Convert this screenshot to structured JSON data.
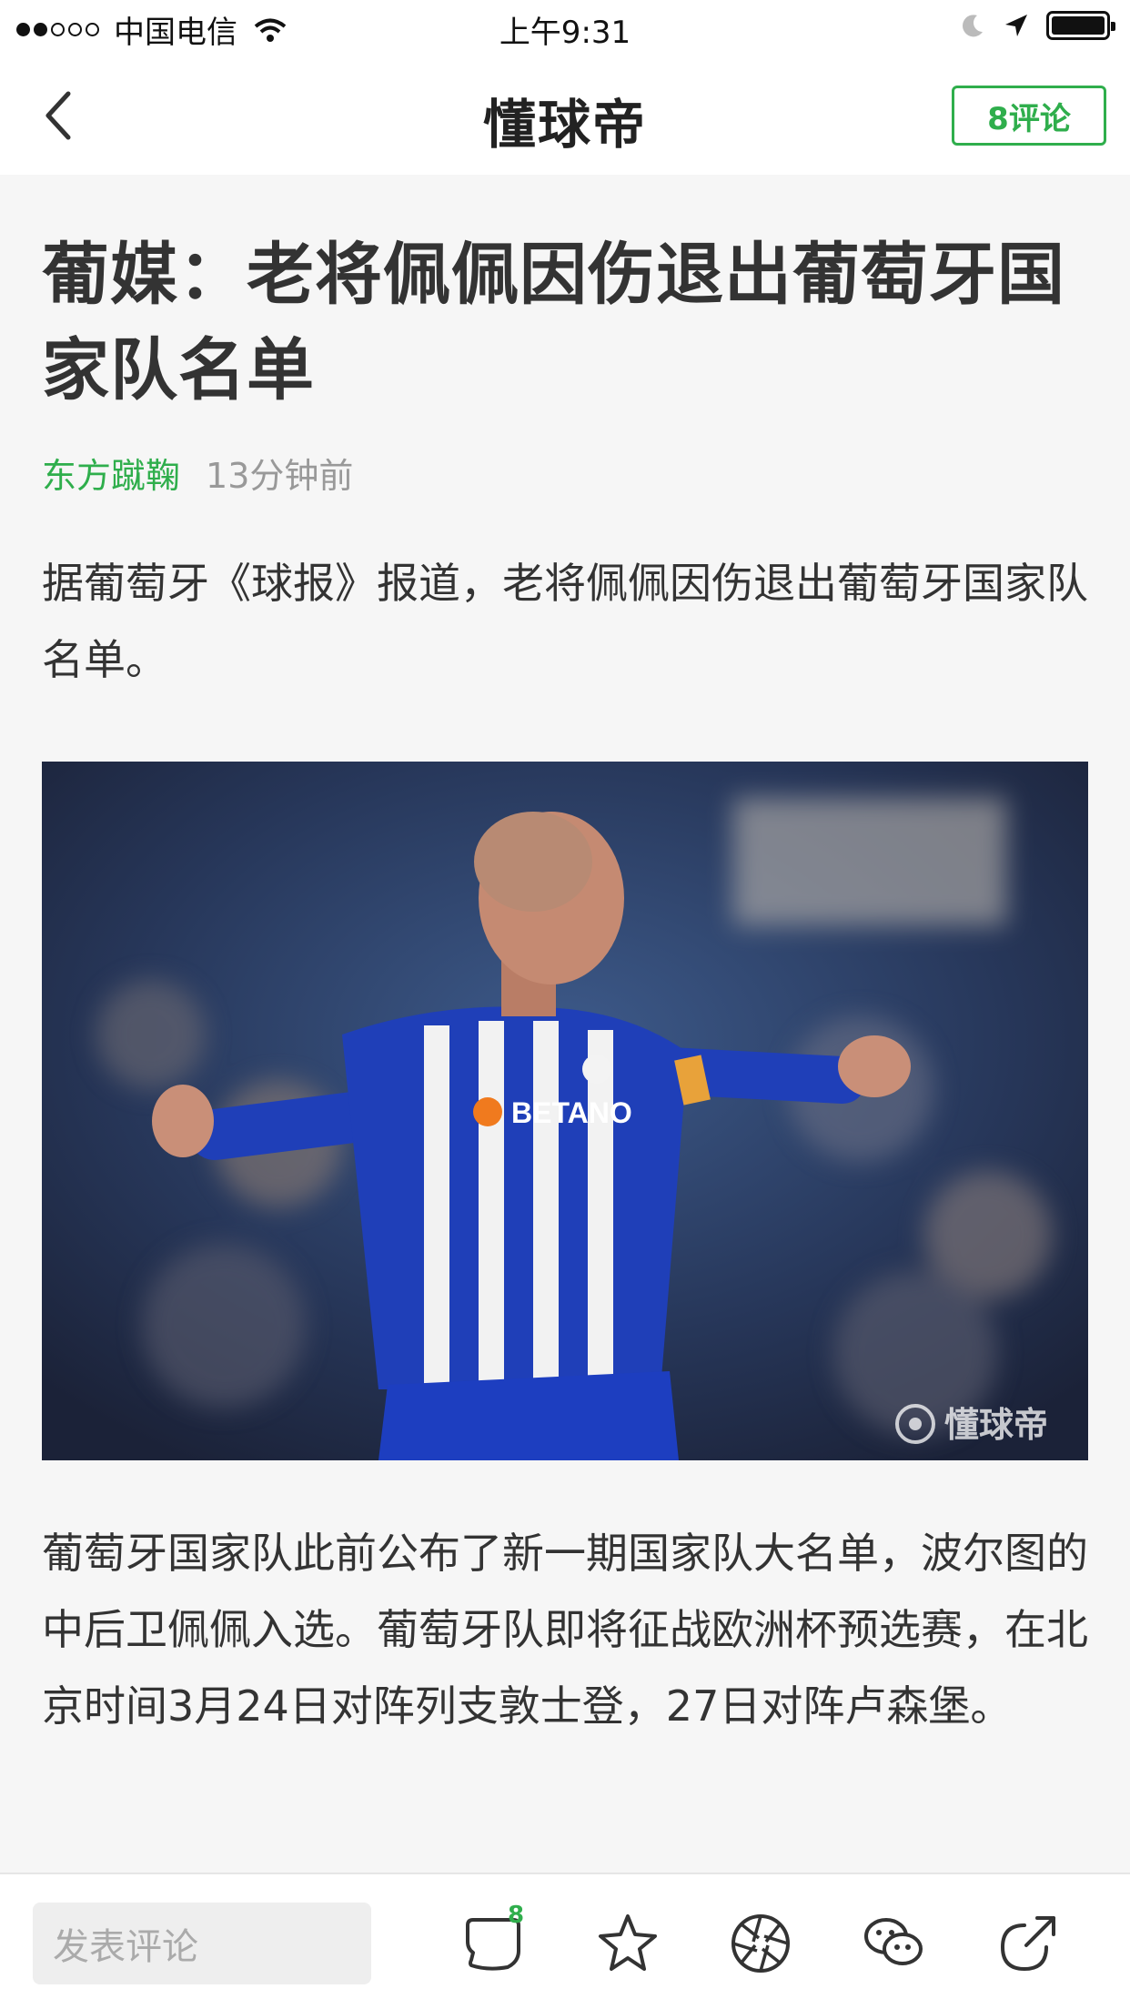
{
  "status_bar": {
    "carrier": "中国电信",
    "time": "上午9:31"
  },
  "nav": {
    "title": "懂球帝",
    "comments_label": "8评论"
  },
  "article": {
    "title": "葡媒：老将佩佩因伤退出葡萄牙国家队名单",
    "source": "东方蹴鞠",
    "time_ago": "13分钟前",
    "paragraph_1": "据葡萄牙《球报》报道，老将佩佩因伤退出葡萄牙国家队名单。",
    "image": {
      "jersey_sponsor": "BETANO",
      "watermark": "懂球帝"
    },
    "paragraph_2": "葡萄牙国家队此前公布了新一期国家队大名单，波尔图的中后卫佩佩入选。葡萄牙队即将征战欧洲杯预选赛，在北京时间3月24日对阵列支敦士登，27日对阵卢森堡。"
  },
  "toolbar": {
    "comment_placeholder": "发表评论",
    "comment_count": "8",
    "icons": [
      "comment-icon",
      "star-icon",
      "moments-icon",
      "wechat-icon",
      "share-icon"
    ]
  },
  "colors": {
    "accent": "#2fae4c",
    "background": "#f6f6f6"
  }
}
